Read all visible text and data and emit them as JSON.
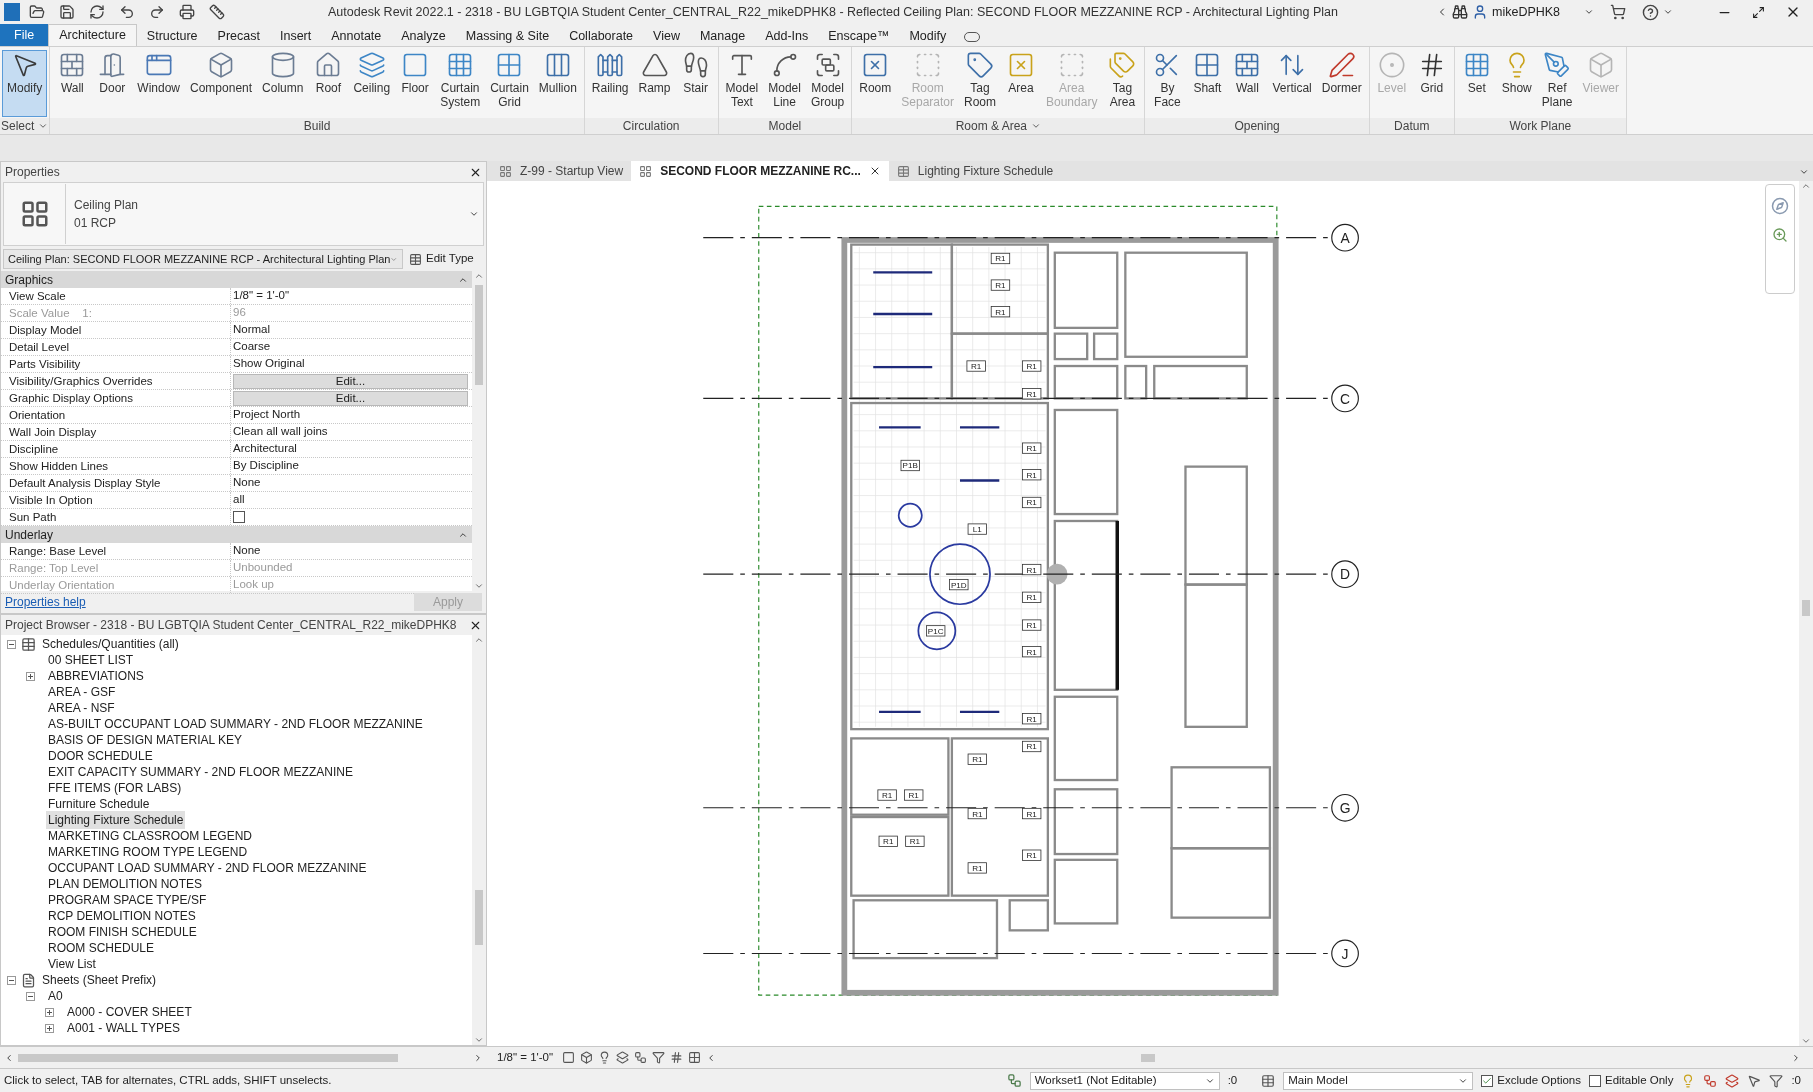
{
  "title_bar": {
    "title": "Autodesk Revit 2022.1 - 2318 - BU LGBTQIA Student Center_CENTRAL_R22_mikeDPHK8 - Reflected Ceiling Plan: SECOND FLOOR MEZZANINE RCP - Architectural Lighting Plan",
    "user": "mikeDPHK8"
  },
  "ribbon_tabs": [
    {
      "label": "File",
      "selected": false,
      "kind": "file"
    },
    {
      "label": "Architecture",
      "selected": true,
      "kind": "tab"
    },
    {
      "label": "Structure",
      "selected": false,
      "kind": "tab"
    },
    {
      "label": "Precast",
      "selected": false,
      "kind": "tab"
    },
    {
      "label": "Insert",
      "selected": false,
      "kind": "tab"
    },
    {
      "label": "Annotate",
      "selected": false,
      "kind": "tab"
    },
    {
      "label": "Analyze",
      "selected": false,
      "kind": "tab"
    },
    {
      "label": "Massing & Site",
      "selected": false,
      "kind": "tab"
    },
    {
      "label": "Collaborate",
      "selected": false,
      "kind": "tab"
    },
    {
      "label": "View",
      "selected": false,
      "kind": "tab"
    },
    {
      "label": "Manage",
      "selected": false,
      "kind": "tab"
    },
    {
      "label": "Add-Ins",
      "selected": false,
      "kind": "tab"
    },
    {
      "label": "Enscape™",
      "selected": false,
      "kind": "tab"
    },
    {
      "label": "Modify",
      "selected": false,
      "kind": "tab"
    }
  ],
  "ribbon_panels": [
    {
      "label": "Select",
      "dropdown": true,
      "tools": [
        {
          "label": "Modify",
          "selected": true,
          "disabled": false
        }
      ]
    },
    {
      "label": "Build",
      "dropdown": false,
      "tools": [
        {
          "label": "Wall",
          "selected": false,
          "disabled": false
        },
        {
          "label": "Door",
          "selected": false,
          "disabled": false
        },
        {
          "label": "Window",
          "selected": false,
          "disabled": false
        },
        {
          "label": "Component",
          "selected": false,
          "disabled": false
        },
        {
          "label": "Column",
          "selected": false,
          "disabled": false
        },
        {
          "label": "Roof",
          "selected": false,
          "disabled": false
        },
        {
          "label": "Ceiling",
          "selected": false,
          "disabled": false
        },
        {
          "label": "Floor",
          "selected": false,
          "disabled": false
        },
        {
          "label": "Curtain\nSystem",
          "selected": false,
          "disabled": false
        },
        {
          "label": "Curtain\nGrid",
          "selected": false,
          "disabled": false
        },
        {
          "label": "Mullion",
          "selected": false,
          "disabled": false
        }
      ]
    },
    {
      "label": "Circulation",
      "dropdown": false,
      "tools": [
        {
          "label": "Railing",
          "selected": false,
          "disabled": false
        },
        {
          "label": "Ramp",
          "selected": false,
          "disabled": false
        },
        {
          "label": "Stair",
          "selected": false,
          "disabled": false
        }
      ]
    },
    {
      "label": "Model",
      "dropdown": false,
      "tools": [
        {
          "label": "Model\nText",
          "selected": false,
          "disabled": false
        },
        {
          "label": "Model\nLine",
          "selected": false,
          "disabled": false
        },
        {
          "label": "Model\nGroup",
          "selected": false,
          "disabled": false
        }
      ]
    },
    {
      "label": "Room & Area",
      "dropdown": true,
      "tools": [
        {
          "label": "Room",
          "selected": false,
          "disabled": false
        },
        {
          "label": "Room\nSeparator",
          "selected": false,
          "disabled": true
        },
        {
          "label": "Tag\nRoom",
          "selected": false,
          "disabled": false
        },
        {
          "label": "Area",
          "selected": false,
          "disabled": false
        },
        {
          "label": "Area\nBoundary",
          "selected": false,
          "disabled": true
        },
        {
          "label": "Tag\nArea",
          "selected": false,
          "disabled": false
        }
      ]
    },
    {
      "label": "Opening",
      "dropdown": false,
      "tools": [
        {
          "label": "By\nFace",
          "selected": false,
          "disabled": false
        },
        {
          "label": "Shaft",
          "selected": false,
          "disabled": false
        },
        {
          "label": "Wall",
          "selected": false,
          "disabled": false
        },
        {
          "label": "Vertical",
          "selected": false,
          "disabled": false
        },
        {
          "label": "Dormer",
          "selected": false,
          "disabled": false
        }
      ]
    },
    {
      "label": "Datum",
      "dropdown": false,
      "tools": [
        {
          "label": "Level",
          "selected": false,
          "disabled": true
        },
        {
          "label": "Grid",
          "selected": false,
          "disabled": false
        }
      ]
    },
    {
      "label": "Work Plane",
      "dropdown": false,
      "tools": [
        {
          "label": "Set",
          "selected": false,
          "disabled": false
        },
        {
          "label": "Show",
          "selected": false,
          "disabled": false
        },
        {
          "label": "Ref\nPlane",
          "selected": false,
          "disabled": false
        },
        {
          "label": "Viewer",
          "selected": false,
          "disabled": true
        }
      ]
    }
  ],
  "properties": {
    "title": "Properties",
    "type_name": "Ceiling Plan",
    "type_sub": "01 RCP",
    "instance": "Ceiling Plan: SECOND FLOOR MEZZANINE RCP - Architectural Lighting Plan",
    "edit_type": "Edit Type",
    "groups": [
      {
        "name": "Graphics",
        "rows": [
          {
            "kind": "text",
            "label": "View Scale",
            "value": "1/8\" = 1'-0\"",
            "disabled": false
          },
          {
            "kind": "text",
            "label": "Scale Value    1:",
            "value": "96",
            "disabled": true
          },
          {
            "kind": "text",
            "label": "Display Model",
            "value": "Normal",
            "disabled": false
          },
          {
            "kind": "text",
            "label": "Detail Level",
            "value": "Coarse",
            "disabled": false
          },
          {
            "kind": "text",
            "label": "Parts Visibility",
            "value": "Show Original",
            "disabled": false
          },
          {
            "kind": "button",
            "label": "Visibility/Graphics Overrides",
            "value": "Edit...",
            "disabled": false
          },
          {
            "kind": "button",
            "label": "Graphic Display Options",
            "value": "Edit...",
            "disabled": false
          },
          {
            "kind": "text",
            "label": "Orientation",
            "value": "Project North",
            "disabled": false
          },
          {
            "kind": "text",
            "label": "Wall Join Display",
            "value": "Clean all wall joins",
            "disabled": false
          },
          {
            "kind": "text",
            "label": "Discipline",
            "value": "Architectural",
            "disabled": false
          },
          {
            "kind": "text",
            "label": "Show Hidden Lines",
            "value": "By Discipline",
            "disabled": false
          },
          {
            "kind": "text",
            "label": "Default Analysis Display Style",
            "value": "None",
            "disabled": false
          },
          {
            "kind": "text",
            "label": "Visible In Option",
            "value": "all",
            "disabled": false
          },
          {
            "kind": "checkbox",
            "label": "Sun Path",
            "checked": false,
            "disabled": false
          }
        ]
      },
      {
        "name": "Underlay",
        "rows": [
          {
            "kind": "text",
            "label": "Range: Base Level",
            "value": "None",
            "disabled": false
          },
          {
            "kind": "text",
            "label": "Range: Top Level",
            "value": "Unbounded",
            "disabled": true
          },
          {
            "kind": "text",
            "label": "Underlay Orientation",
            "value": "Look up",
            "disabled": true
          }
        ]
      }
    ],
    "help": "Properties help",
    "apply": "Apply",
    "apply_disabled": true
  },
  "project_browser": {
    "title": "Project Browser - 2318 - BU LGBTQIA Student Center_CENTRAL_R22_mikeDPHK8",
    "tree": [
      {
        "label": "Schedules/Quantities (all)",
        "kind": "schedules",
        "expanded": true,
        "selected": false,
        "children": [
          {
            "label": "00 SHEET LIST",
            "selected": false
          },
          {
            "label": "ABBREVIATIONS",
            "expanded": false,
            "selected": false
          },
          {
            "label": "AREA - GSF",
            "selected": false
          },
          {
            "label": "AREA - NSF",
            "selected": false
          },
          {
            "label": "AS-BUILT OCCUPANT LOAD SUMMARY - 2ND FLOOR MEZZANINE",
            "selected": false
          },
          {
            "label": "BASIS OF DESIGN MATERIAL KEY",
            "selected": false
          },
          {
            "label": "DOOR SCHEDULE",
            "selected": false
          },
          {
            "label": "EXIT CAPACITY SUMMARY - 2ND FLOOR MEZZANINE",
            "selected": false
          },
          {
            "label": "FFE ITEMS (FOR LABS)",
            "selected": false
          },
          {
            "label": "Furniture Schedule",
            "selected": false
          },
          {
            "label": "Lighting Fixture Schedule",
            "selected": true
          },
          {
            "label": "MARKETING CLASSROOM LEGEND",
            "selected": false
          },
          {
            "label": "MARKETING ROOM TYPE LEGEND",
            "selected": false
          },
          {
            "label": "OCCUPANT LOAD SUMMARY - 2ND FLOOR MEZZANINE",
            "selected": false
          },
          {
            "label": "PLAN DEMOLITION NOTES",
            "selected": false
          },
          {
            "label": "PROGRAM SPACE TYPE/SF",
            "selected": false
          },
          {
            "label": "RCP DEMOLITION NOTES",
            "selected": false
          },
          {
            "label": "ROOM FINISH SCHEDULE",
            "selected": false
          },
          {
            "label": "ROOM SCHEDULE",
            "selected": false
          },
          {
            "label": "View List",
            "selected": false
          }
        ]
      },
      {
        "label": "Sheets (Sheet Prefix)",
        "kind": "sheets",
        "expanded": true,
        "selected": false,
        "children": [
          {
            "label": "A0",
            "expanded": true,
            "selected": false,
            "children": [
              {
                "label": "A000 - COVER SHEET",
                "expanded": false,
                "selected": false
              },
              {
                "label": "A001 - WALL TYPES",
                "expanded": false,
                "selected": false
              }
            ]
          }
        ]
      }
    ]
  },
  "view_tabs": [
    {
      "label": "Z-99 - Startup View",
      "kind": "plan",
      "selected": false
    },
    {
      "label": "SECOND FLOOR MEZZANINE RC...",
      "kind": "plan",
      "selected": true
    },
    {
      "label": "Lighting Fixture Schedule",
      "kind": "schedule",
      "selected": false
    }
  ],
  "plan": {
    "grids": [
      "A",
      "C",
      "D",
      "G",
      "J"
    ],
    "tags": [
      "R1",
      "R1",
      "R1",
      "R1",
      "R1",
      "R1",
      "R1",
      "R1",
      "R1",
      "R1",
      "R1",
      "R1",
      "R1",
      "R1",
      "R1",
      "R1",
      "R1",
      "R1",
      "R1",
      "R1",
      "R1",
      "R1",
      "R1",
      "R1",
      "P1B",
      "P1D",
      "P1C",
      "L1"
    ]
  },
  "view_control": {
    "scale": "1/8\" = 1'-0\""
  },
  "status_bar": {
    "message": "Click to select, TAB for alternates, CTRL adds, SHIFT unselects.",
    "workset": "Workset1 (Not Editable)",
    "count": ":0",
    "model": "Main Model",
    "exclude_options": {
      "label": "Exclude Options",
      "checked": true
    },
    "editable_only": {
      "label": "Editable Only",
      "checked": false
    },
    "filter_count": ":0"
  }
}
